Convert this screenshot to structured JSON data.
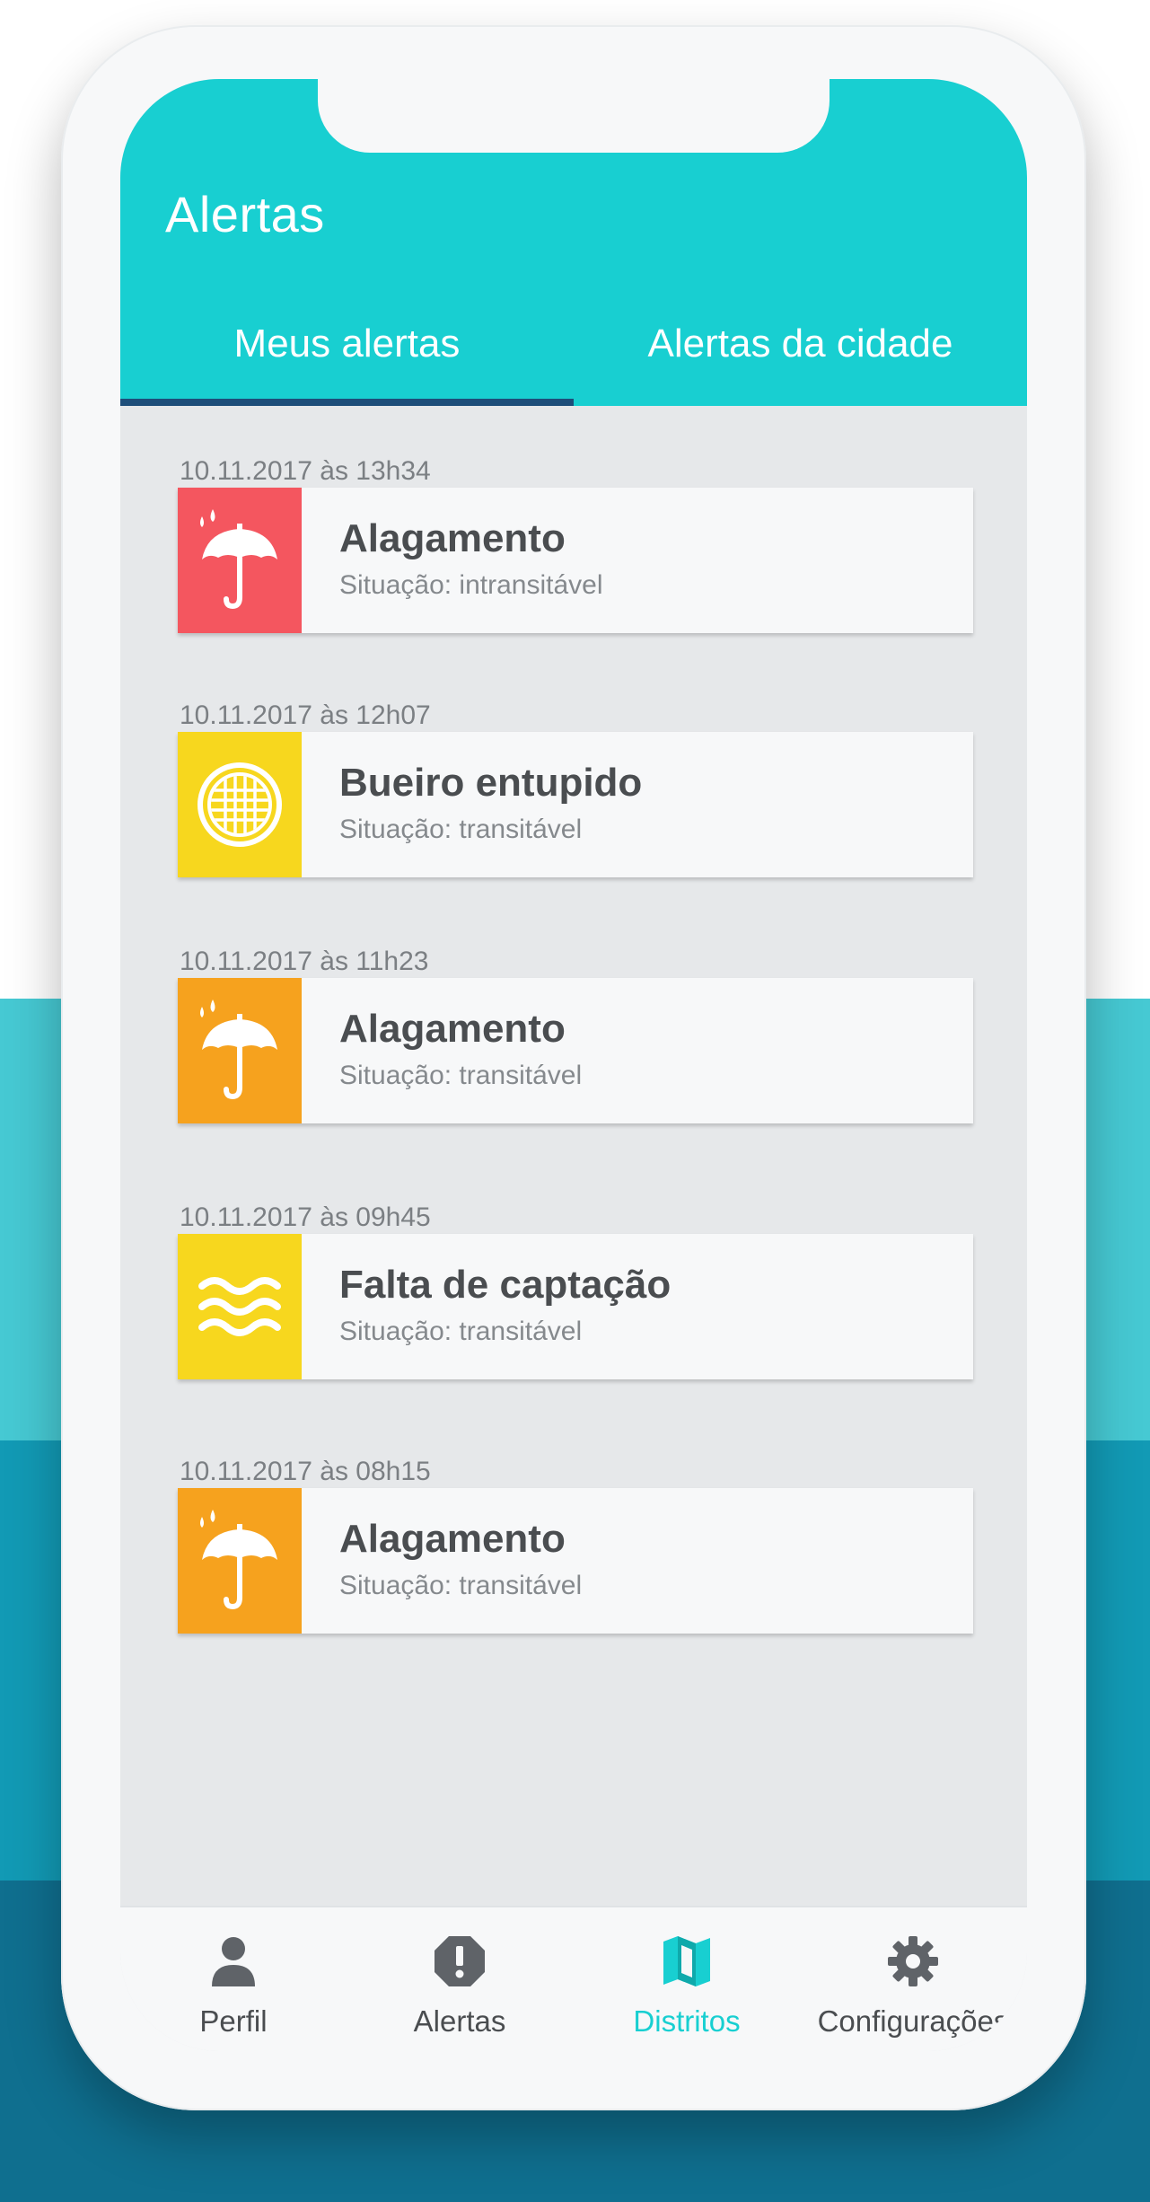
{
  "app_title": "Alertas",
  "tabs": [
    {
      "label": "Meus alertas",
      "active": true
    },
    {
      "label": "Alertas da cidade",
      "active": false
    }
  ],
  "alerts": [
    {
      "time": "10.11.2017 às 13h34",
      "title": "Alagamento",
      "status": "Situação: intransitável",
      "icon": "umbrella-rain-icon",
      "color": "#f4565f"
    },
    {
      "time": "10.11.2017 às 12h07",
      "title": "Bueiro entupido",
      "status": "Situação: transitável",
      "icon": "drain-grate-icon",
      "color": "#f7d71e"
    },
    {
      "time": "10.11.2017 às 11h23",
      "title": "Alagamento",
      "status": "Situação: transitável",
      "icon": "umbrella-rain-icon",
      "color": "#f6a21e"
    },
    {
      "time": "10.11.2017 às 09h45",
      "title": "Falta de captação",
      "status": "Situação: transitável",
      "icon": "waves-icon",
      "color": "#f7d71e"
    },
    {
      "time": "10.11.2017 às 08h15",
      "title": "Alagamento",
      "status": "Situação: transitável",
      "icon": "umbrella-rain-icon",
      "color": "#f6a21e"
    }
  ],
  "bottom_nav": [
    {
      "label": "Perfil",
      "icon": "person-icon",
      "active": false
    },
    {
      "label": "Alertas",
      "icon": "alert-octagon-icon",
      "active": false
    },
    {
      "label": "Distritos",
      "icon": "map-icon",
      "active": true
    },
    {
      "label": "Configurações",
      "icon": "gear-icon",
      "active": false
    }
  ],
  "colors": {
    "accent": "#18cfd1",
    "tab_indicator": "#1e4e7a",
    "nav_icon": "#5f6368",
    "bg_light": "#46c9d3",
    "bg_mid": "#129ab5",
    "bg_dark": "#0f6f8f"
  }
}
